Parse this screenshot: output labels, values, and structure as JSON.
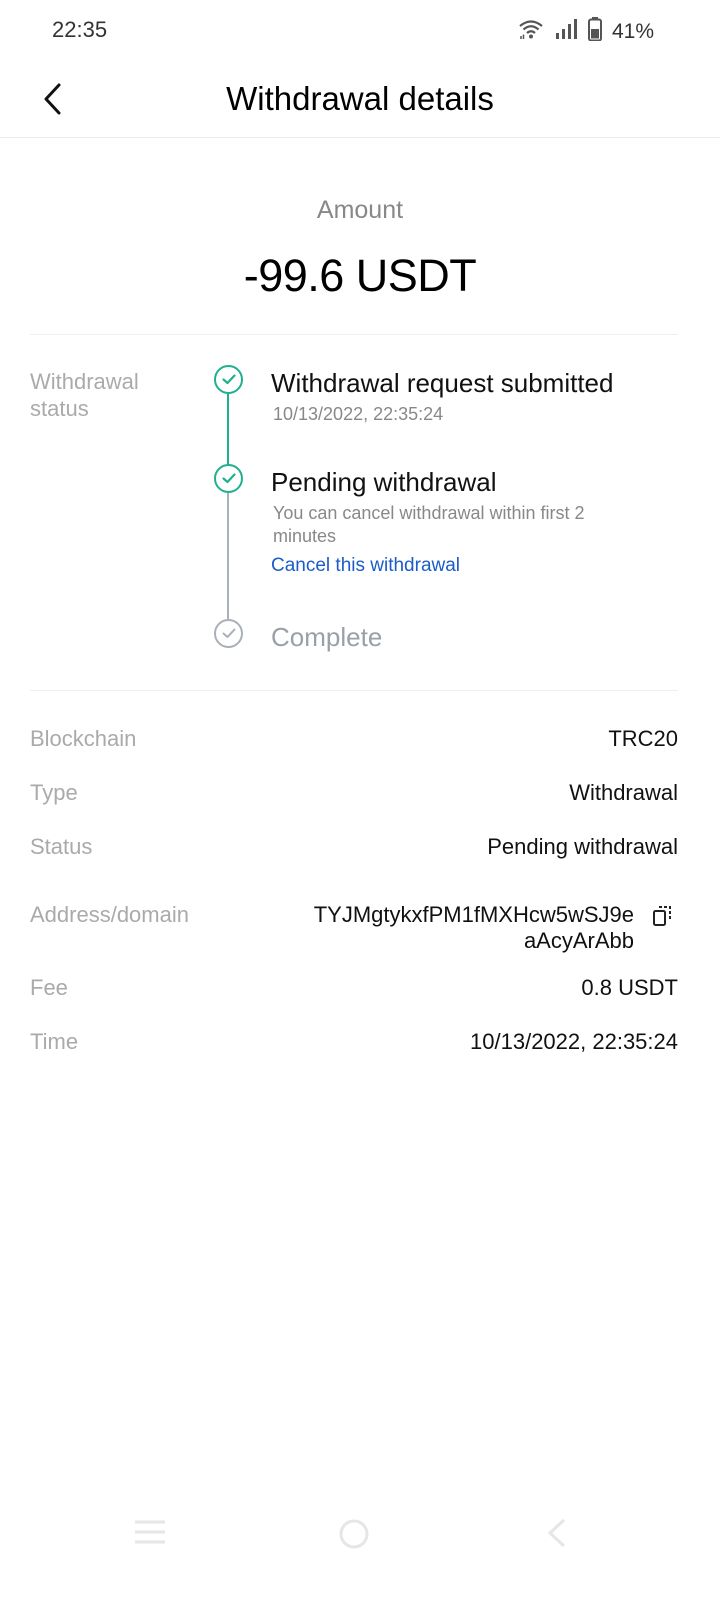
{
  "status_bar": {
    "time": "22:35",
    "battery_text": "41%",
    "icons": [
      "wifi-icon",
      "signal-icon",
      "battery-icon"
    ]
  },
  "header": {
    "title": "Withdrawal details",
    "back_icon": "chevron-left-icon"
  },
  "amount": {
    "label": "Amount",
    "value": "-99.6 USDT"
  },
  "withdrawal_status": {
    "label": "Withdrawal status",
    "steps": [
      {
        "title": "Withdrawal request submitted",
        "subtitle": "10/13/2022, 22:35:24",
        "state": "done"
      },
      {
        "title": "Pending withdrawal",
        "subtitle": "You can cancel withdrawal within first 2 minutes",
        "link": "Cancel this withdrawal",
        "state": "done"
      },
      {
        "title": "Complete",
        "state": "pending"
      }
    ],
    "colors": {
      "done": "#1fb18e",
      "pending": "#aab0b8",
      "link": "#1a5cc8"
    }
  },
  "details": {
    "blockchain": {
      "label": "Blockchain",
      "value": "TRC20"
    },
    "type": {
      "label": "Type",
      "value": "Withdrawal"
    },
    "status": {
      "label": "Status",
      "value": "Pending withdrawal"
    },
    "address": {
      "label": "Address/domain",
      "value": "TYJMgtykxfPM1fMXHcw5wSJ9eaAcyArAbb"
    },
    "fee": {
      "label": "Fee",
      "value": "0.8 USDT"
    },
    "time": {
      "label": "Time",
      "value": "10/13/2022, 22:35:24"
    }
  },
  "nav_bar": {
    "icons": [
      "menu-icon",
      "home-icon",
      "back-icon"
    ]
  }
}
